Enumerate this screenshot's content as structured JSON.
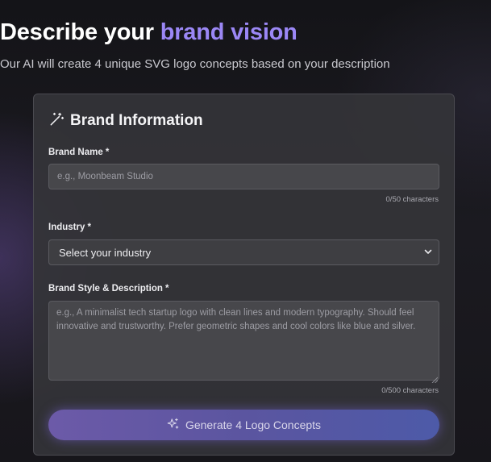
{
  "header": {
    "title_prefix": "Describe your",
    "title_accent": "brand vision",
    "subtitle": "Our AI will create 4 unique SVG logo concepts based on your description"
  },
  "card": {
    "icon": "magic-wand-icon",
    "title": "Brand Information"
  },
  "brand_name": {
    "label": "Brand Name *",
    "value": "",
    "placeholder": "e.g., Moonbeam Studio",
    "counter": "0/50 characters"
  },
  "industry": {
    "label": "Industry *",
    "selected": "Select your industry",
    "icon": "chevron-down-icon"
  },
  "style": {
    "label": "Brand Style & Description *",
    "value": "",
    "placeholder": "e.g., A minimalist tech startup logo with clean lines and modern typography. Should feel innovative and trustworthy. Prefer geometric shapes and cool colors like blue and silver.",
    "counter": "0/500 characters"
  },
  "generate_button": {
    "label": "Generate 4 Logo Concepts",
    "icon": "sparkles-icon"
  },
  "colors": {
    "accent": "#9b87f5",
    "background": "#17161b",
    "card": "#343438",
    "button_start": "#6c5aa8",
    "button_end": "#4d5aa8"
  }
}
